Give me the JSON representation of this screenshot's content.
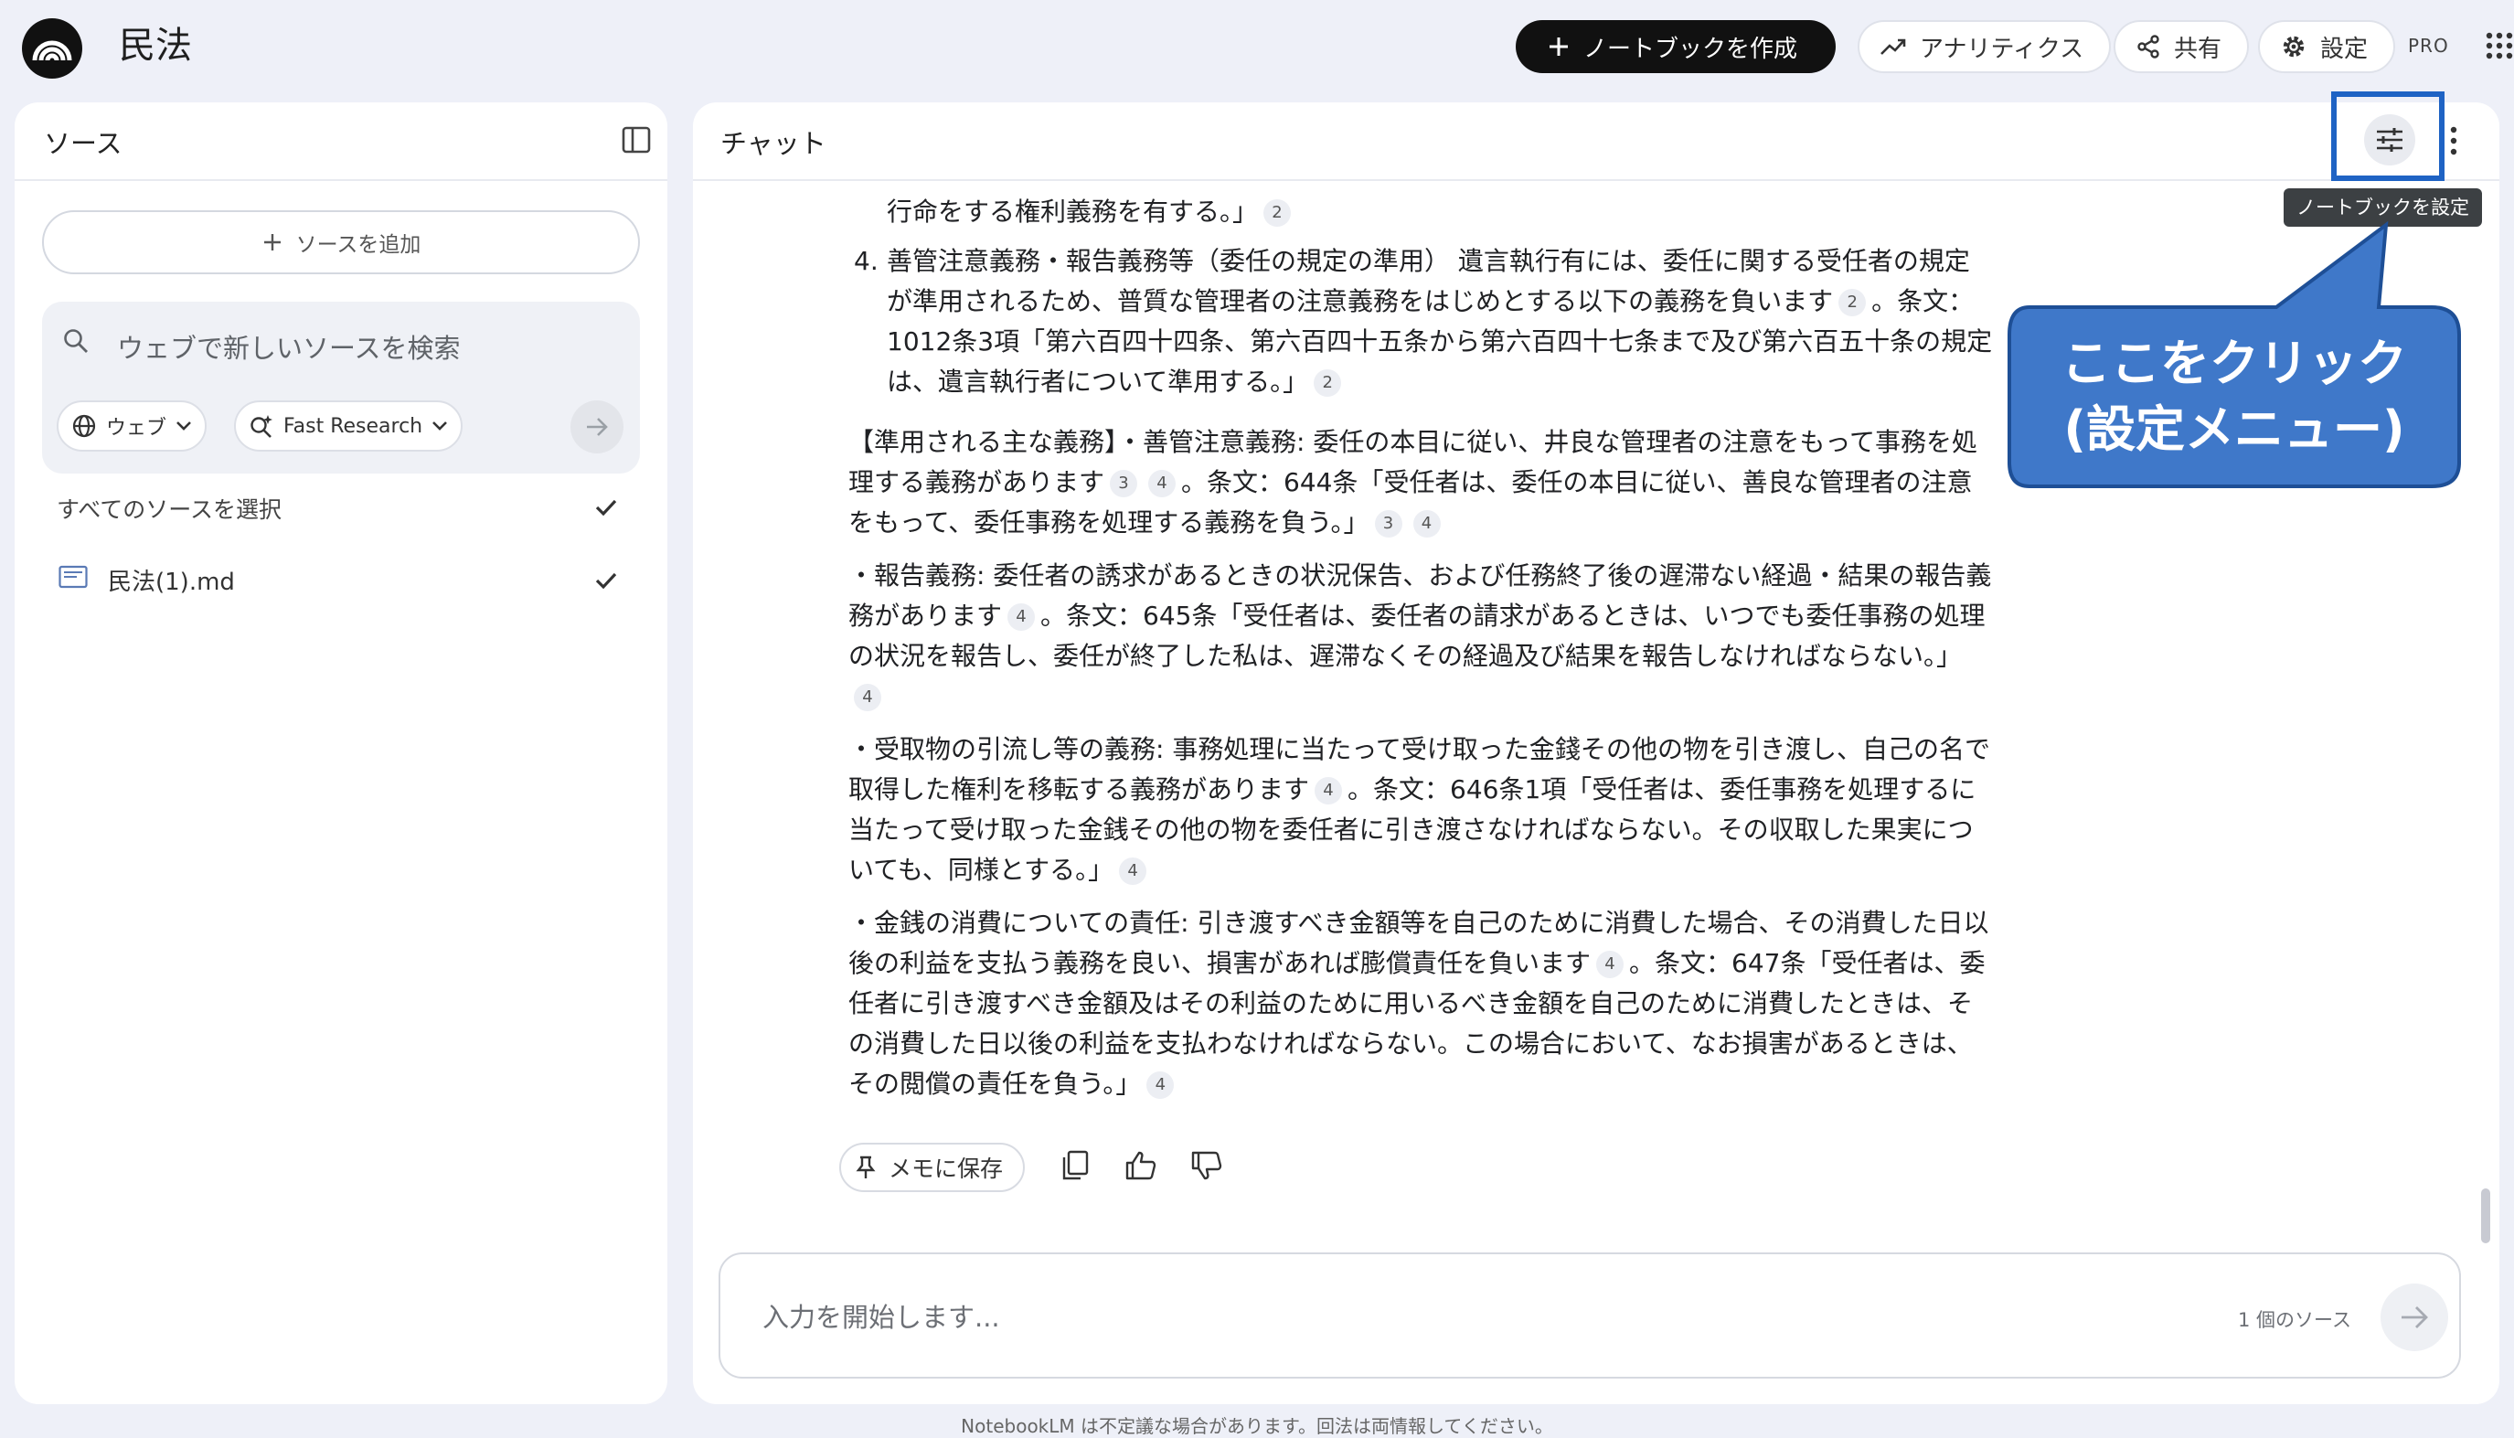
{
  "app": {
    "title": "民法"
  },
  "topbar": {
    "create_notebook": "ノートブックを作成",
    "analytics": "アナリティクス",
    "share": "共有",
    "settings": "設定",
    "plan_badge": "PRO"
  },
  "sources_panel": {
    "title": "ソース",
    "add_source": "ソースを追加",
    "search_placeholder": "ウェブで新しいソースを検索",
    "web_chip": "ウェブ",
    "research_chip": "Fast Research",
    "select_all": "すべてのソースを選択",
    "items": [
      {
        "label": "民法(1).md",
        "checked": true
      }
    ]
  },
  "chat_panel": {
    "title": "チャット",
    "settings_tooltip": "ノートブックを設定",
    "messages": {
      "m1_text": "行命をする権利義務を有する。」",
      "m1_cite": "2",
      "item4_num": "4.",
      "item4_text1": "善管注意義務・報告義務等（委任の規定の準用） 遺言執行有には、委任に関する受任者の規定が準用されるため、普質な管理者の注意義務をはじめとする以下の義務を負います",
      "item4_cite1": "2",
      "item4_text2": "。条文：1012条3項「第六百四十四条、第六百四十五条から第六百四十七条まで及び第六百五十条の規定は、遺言執行者について準用する。」",
      "item4_cite2": "2",
      "p1_text1": "【準用される主な義務】・善管注意義務: 委任の本目に従い、井良な管理者の注意をもって事務を処理する義務があります",
      "p1_cite1": "3",
      "p1_cite2": "4",
      "p1_text2": "。条文：644条「受任者は、委任の本目に従い、善良な管理者の注意をもって、委任事務を処理する義務を負う。」",
      "p1_cite3": "3",
      "p1_cite4": "4",
      "p2_text1": "・報告義務: 委任者の誘求があるときの状況保告、および任務終了後の遅滞ない経過・結果の報告義務があります",
      "p2_cite1": "4",
      "p2_text2": "。条文：645条「受任者は、委任者の請求があるときは、いつでも委任事務の処理の状況を報告し、委任が終了した私は、遅滞なくその経過及び結果を報告しなければならない。」",
      "p2_cite2": "4",
      "p3_text1": "・受取物の引流し等の義務: 事務処理に当たって受け取った金錢その他の物を引き渡し、自己の名で取得した権利を移転する義務があります",
      "p3_cite1": "4",
      "p3_text2": "。条文：646条1項「受任者は、委任事務を処理するに当たって受け取った金銭その他の物を委任者に引き渡さなければならない。その収取した果実についても、同様とする。」",
      "p3_cite2": "4",
      "p4_text1": "・金銭の消費についての責任: 引き渡すべき金額等を自己のために消費した場合、その消費した日以後の利益を支払う義務を良い、損害があれば膨償責任を負います",
      "p4_cite1": "4",
      "p4_text2": "。条文：647条「受任者は、委任者に引き渡すべき金額及はその利益のために用いるべき金額を自己のために消費したときは、その消費した日以後の利益を支払わなければならない。この場合において、なお損害があるときは、その閲償の責任を負う。」",
      "p4_cite2": "4"
    },
    "save_to_note": "メモに保存",
    "input_placeholder": "入力を開始します...",
    "source_count": "1 個のソース"
  },
  "footer": {
    "disclaimer": "NotebookLM は不定議な場合があります。回法は両情報してください。"
  },
  "annotation": {
    "callout_line1": "ここをクリック",
    "callout_line2": "(設定メニュー)",
    "color": "#1f63c4"
  },
  "colors": {
    "background": "#eef0f8",
    "accent": "#1f63c4",
    "callout": "#3f78c9",
    "check": "#333333"
  }
}
